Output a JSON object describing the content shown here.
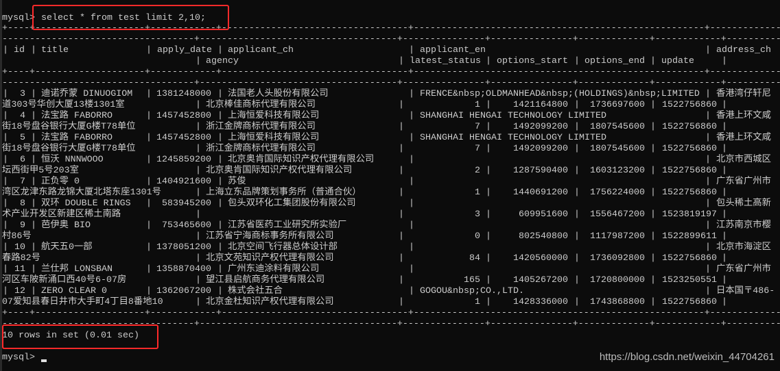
{
  "terminal": {
    "prompt": "mysql>",
    "command": "select * from test limit 2,10;",
    "result_summary": "10 rows in set (0.01 sec)",
    "final_prompt": "mysql>",
    "watermark": "https://blog.csdn.net/weixin_44704261"
  },
  "highlight_color": "#ff2a2a",
  "columns": {
    "id": "id",
    "title": "title",
    "apply_date": "apply_date",
    "applicant_ch": "applicant_ch",
    "applicant_en": "applicant_en",
    "address_ch": "address_ch",
    "agency": "agency",
    "latest_status": "latest_status",
    "options_start": "options_start",
    "options_end": "options_end",
    "update": "update"
  },
  "rows": [
    {
      "id": "3",
      "title": "迪诺乔蒙 DINUOGIOM",
      "apply_date": "1381248000",
      "applicant_ch": "法国老人头股份有限公司",
      "applicant_en": "FRENCE&nbsp;OLDMANHEAD&nbsp;(HOLDINGS)&nbsp;LIMITED",
      "address_ch": "香港湾仔轩尼",
      "address_cont": "道303号华创大厦13楼1301室",
      "agency": "北京棒佳商标代理有限公司",
      "latest_status": "1",
      "options_start": "1421164800",
      "options_end": "1736697600",
      "update": "1522756860"
    },
    {
      "id": "4",
      "title": "法宝路 FABORRO",
      "apply_date": "1457452800",
      "applicant_ch": "上海恒爱科技有限公司",
      "applicant_en": "SHANGHAI HENGAI TECHNOLOGY LIMITED",
      "address_ch": "香港上环文咸",
      "address_cont": "街18号盘谷银行大厦G楼T78单位",
      "agency": "浙江金牌商标代理有限公司",
      "latest_status": "7",
      "options_start": "1492099200",
      "options_end": "1807545600",
      "update": "1522756860"
    },
    {
      "id": "5",
      "title": "法宝路 FABORRO",
      "apply_date": "1457452800",
      "applicant_ch": "上海恒爱科技有限公司",
      "applicant_en": "SHANGHAI HENGAI TECHNOLOGY LIMITED",
      "address_ch": "香港上环文咸",
      "address_cont": "街18号盘谷银行大厦G楼T78单位",
      "agency": "浙江金牌商标代理有限公司",
      "latest_status": "7",
      "options_start": "1492099200",
      "options_end": "1807545600",
      "update": "1522756860"
    },
    {
      "id": "6",
      "title": "恒沃 NNNWOOO",
      "apply_date": "1245859200",
      "applicant_ch": "北京奥肯国际知识产权代理有限公司",
      "applicant_en": "",
      "address_ch": "北京市西城区",
      "address_cont": "坛西街甲5号203室",
      "agency": "北京奥肯国际知识产权代理有限公司",
      "latest_status": "2",
      "options_start": "1287590400",
      "options_end": "1603123200",
      "update": "1522756860"
    },
    {
      "id": "7",
      "title": "正负零 0",
      "apply_date": "1404921600",
      "applicant_ch": "苏俊",
      "applicant_en": "",
      "address_ch": "广东省广州市",
      "address_cont": "湾区龙津东路龙锦大厦北塔东座1301号",
      "agency": "上海立东品牌策划事务所（普通合伙）",
      "latest_status": "1",
      "options_start": "1440691200",
      "options_end": "1756224000",
      "update": "1522756860"
    },
    {
      "id": "8",
      "title": "双环 DOUBLE RINGS",
      "apply_date": "583945200",
      "applicant_ch": "包头双环化工集团股份有限公司",
      "applicant_en": "",
      "address_ch": "包头稀土高新",
      "address_cont": "术产业开发区新建区稀土南路",
      "agency": "",
      "latest_status": "3",
      "options_start": "609951600",
      "options_end": "1556467200",
      "update": "1523819197"
    },
    {
      "id": "9",
      "title": "芭伊奥 BIO",
      "apply_date": "753465600",
      "applicant_ch": "江苏省医药工业研究所实验厂",
      "applicant_en": "",
      "address_ch": "江苏南京市樱",
      "address_cont": "村86号",
      "agency": "江苏省宁海商标事务所有限公司",
      "latest_status": "0",
      "options_start": "802540800",
      "options_end": "1117987200",
      "update": "1522899611"
    },
    {
      "id": "10",
      "title": "航天五0一部",
      "apply_date": "1378051200",
      "applicant_ch": "北京空间飞行器总体设计部",
      "applicant_en": "",
      "address_ch": "北京市海淀区",
      "address_cont": "春路82号",
      "agency": "北京文苑知识产权代理有限公司",
      "latest_status": "84",
      "options_start": "1420560000",
      "options_end": "1736092800",
      "update": "1522756860"
    },
    {
      "id": "11",
      "title": "兰仕邦 LONSBAN",
      "apply_date": "1358870400",
      "applicant_ch": "广州东迪涂料有限公司",
      "applicant_en": "",
      "address_ch": "广东省广州市",
      "address_cont": "河区车陂新涌口西40号6-07房",
      "agency": "望江县启航商务代理有限公司",
      "latest_status": "165",
      "options_start": "1405267200",
      "options_end": "1720800000",
      "update": "1523250551"
    },
    {
      "id": "12",
      "title": "ZERO CLEAR 0",
      "apply_date": "1362067200",
      "applicant_ch": "株式会社五合",
      "applicant_en": "GOGOU&nbsp;CO.,LTD.",
      "address_ch": "日本国〒486-",
      "address_cont": "07爱知县春日井市大手町4丁目8番地10",
      "agency": "北京金杜知识产权代理有限公司",
      "latest_status": "1",
      "options_start": "1428336000",
      "options_end": "1743868800",
      "update": "1522756860"
    }
  ]
}
